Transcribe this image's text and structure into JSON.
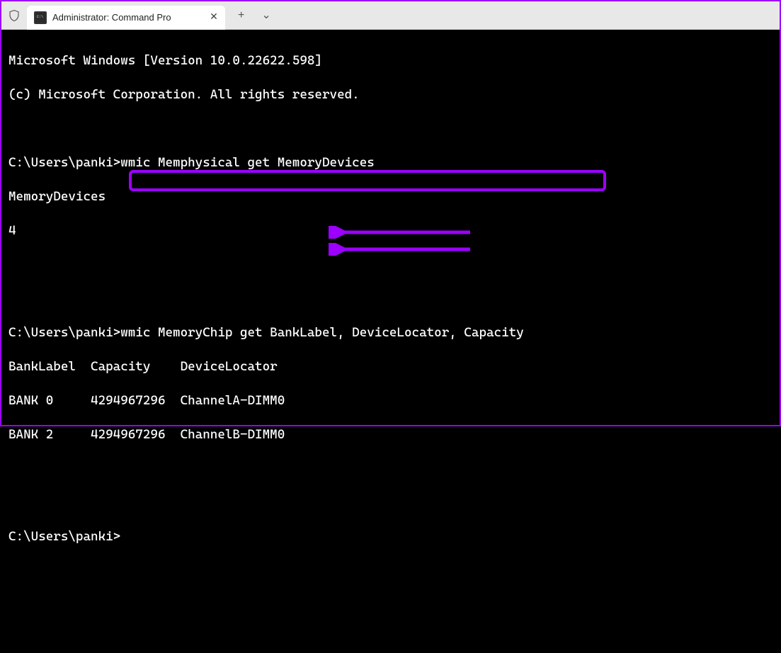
{
  "titlebar": {
    "tab_title": "Administrator: Command Pro",
    "close_symbol": "✕",
    "add_symbol": "+",
    "dropdown_symbol": "⌄"
  },
  "terminal": {
    "line1": "Microsoft Windows [Version 10.0.22622.598]",
    "line2": "(c) Microsoft Corporation. All rights reserved.",
    "prompt1": "C:\\Users\\panki>",
    "cmd1": "wmic Memphysical get MemoryDevices",
    "out1_header": "MemoryDevices",
    "out1_value": "4",
    "prompt2": "C:\\Users\\panki>",
    "cmd2": "wmic MemoryChip get BankLabel, DeviceLocator, Capacity",
    "table_header": "BankLabel  Capacity    DeviceLocator",
    "table_row1": "BANK 0     4294967296  ChannelA-DIMM0",
    "table_row2": "BANK 2     4294967296  ChannelB-DIMM0",
    "prompt3": "C:\\Users\\panki>"
  }
}
